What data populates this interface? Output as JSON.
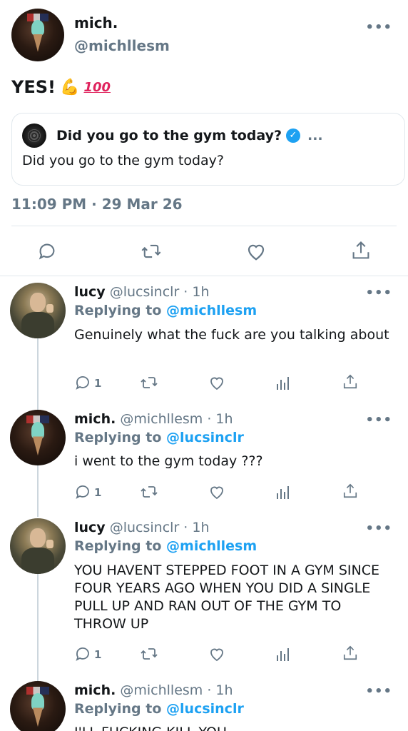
{
  "main_tweet": {
    "name": "mich.",
    "handle": "@michllesm",
    "text": "YES!",
    "emoji_arm": "💪",
    "emoji_100": "100",
    "more": "•••",
    "quote": {
      "title": "Did you go to the gym today?",
      "dots": "...",
      "text": "Did you go to the gym today?"
    },
    "timestamp": "11:09 PM · 29 Mar 26"
  },
  "replies": [
    {
      "name": "lucy",
      "meta": "@lucsinclr · 1h",
      "replying_prefix": "Replying to",
      "mention": "@michllesm",
      "text": "Genuinely what the fuck are you talking about",
      "reply_count": "1"
    },
    {
      "name": "mich.",
      "meta": "@michllesm · 1h",
      "replying_prefix": "Replying to",
      "mention": "@lucsinclr",
      "text": "i went to the gym today ???",
      "reply_count": "1"
    },
    {
      "name": "lucy",
      "meta": "@lucsinclr · 1h",
      "replying_prefix": "Replying to",
      "mention": "@michllesm",
      "text": "YOU HAVENT STEPPED FOOT IN A GYM SINCE FOUR YEARS AGO WHEN YOU DID A SINGLE PULL UP AND RAN OUT OF THE GYM TO THROW UP",
      "reply_count": "1"
    },
    {
      "name": "mich.",
      "meta": "@michllesm · 1h",
      "replying_prefix": "Replying to",
      "mention": "@lucsinclr",
      "text": "I'LL FUCKING KILL YOU"
    }
  ],
  "icons": [
    "comment-icon",
    "retweet-icon",
    "heart-icon",
    "share-icon",
    "analytics-icon",
    "verified-icon",
    "more-icon"
  ],
  "colors": {
    "accent": "#1da1f2",
    "muted": "#657786",
    "border": "#e1e8ed",
    "text": "#14171a"
  }
}
